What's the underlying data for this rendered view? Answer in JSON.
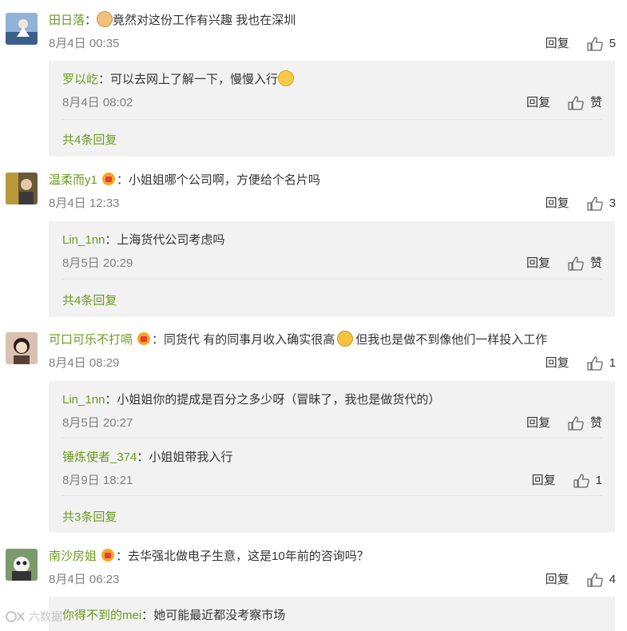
{
  "comments": [
    {
      "user": "田日落",
      "sep": "：",
      "text": "竟然对这份工作有兴趣 我也在深圳",
      "time": "8月4日 00:35",
      "reply": "回复",
      "likes": "5",
      "replies": [
        {
          "user": "罗以屹",
          "sep": "：",
          "text": "可以去网上了解一下，慢慢入行",
          "time": "8月4日 08:02",
          "reply": "回复",
          "likes": "赞"
        }
      ],
      "more": "共4条回复"
    },
    {
      "user": "温柔而y1",
      "sep": "：",
      "text": "小姐姐哪个公司啊，方便给个名片吗",
      "time": "8月4日 12:33",
      "reply": "回复",
      "likes": "3",
      "replies": [
        {
          "user": "Lin_1nn",
          "sep": "：",
          "text": "上海货代公司考虑吗",
          "time": "8月5日 20:29",
          "reply": "回复",
          "likes": "赞"
        }
      ],
      "more": "共4条回复"
    },
    {
      "user": "可口可乐不打嗝",
      "sep": "：",
      "text": "同货代 有的同事月收入确实很高",
      "text2": "但我也是做不到像他们一样投入工作",
      "time": "8月4日 08:29",
      "reply": "回复",
      "likes": "1",
      "replies": [
        {
          "user": "Lin_1nn",
          "sep": "：",
          "text": "小姐姐你的提成是百分之多少呀（冒昧了，我也是做货代的）",
          "time": "8月5日 20:27",
          "reply": "回复",
          "likes": "赞"
        },
        {
          "user": "锤炼使者_374",
          "sep": "：",
          "text": "小姐姐带我入行",
          "time": "8月9日 18:21",
          "reply": "回复",
          "likes": "1"
        }
      ],
      "more": "共3条回复"
    },
    {
      "user": "南沙房姐",
      "sep": "：",
      "text": "去华强北做电子生意，这是10年前的咨询吗？",
      "time": "8月4日 06:23",
      "reply": "回复",
      "likes": "4",
      "replies": [
        {
          "user": "你得不到的mei",
          "sep": "：",
          "text": "她可能最近都没考察市场"
        }
      ]
    }
  ],
  "watermark": "六数据",
  "colors": {
    "username": "#6b9b1e",
    "meta": "#808080",
    "reply_bg": "#f2f2f2"
  }
}
